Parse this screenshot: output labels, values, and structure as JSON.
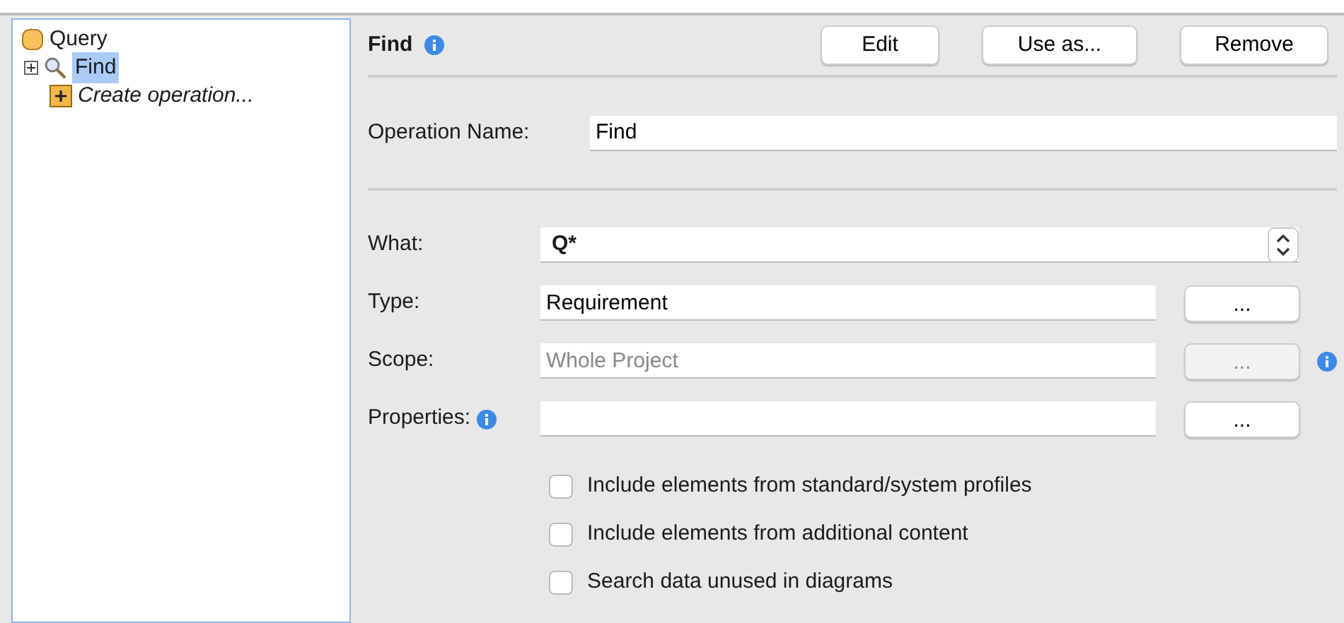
{
  "tree": {
    "label": "Query",
    "children": [
      {
        "label": "Find",
        "selected": true,
        "kind": "find",
        "expanded": false
      },
      {
        "label": "Create operation...",
        "selected": false,
        "kind": "create"
      }
    ]
  },
  "header": {
    "title": "Find",
    "buttons": [
      "Edit",
      "Use as...",
      "Remove"
    ]
  },
  "operation_name": {
    "label": "Operation Name:",
    "value": "Find"
  },
  "fields": [
    {
      "kind": "select",
      "label": "What:",
      "value": "Q*",
      "info": false
    },
    {
      "kind": "text",
      "label": "Type:",
      "value": "Requirement",
      "button": "...",
      "disabled": false,
      "info": false,
      "trailing_info": false
    },
    {
      "kind": "text",
      "label": "Scope:",
      "value": "Whole Project",
      "button": "...",
      "disabled": true,
      "info": false,
      "trailing_info": true
    },
    {
      "kind": "text",
      "label": "Properties:",
      "button": "...",
      "disabled": false,
      "info": true,
      "trailing_info": false
    }
  ],
  "options": [
    {
      "label": "Include elements from standard/system profiles",
      "checked": false
    },
    {
      "label": "Include elements from additional content",
      "checked": false
    },
    {
      "label": "Search data unused in diagrams",
      "checked": false
    }
  ]
}
